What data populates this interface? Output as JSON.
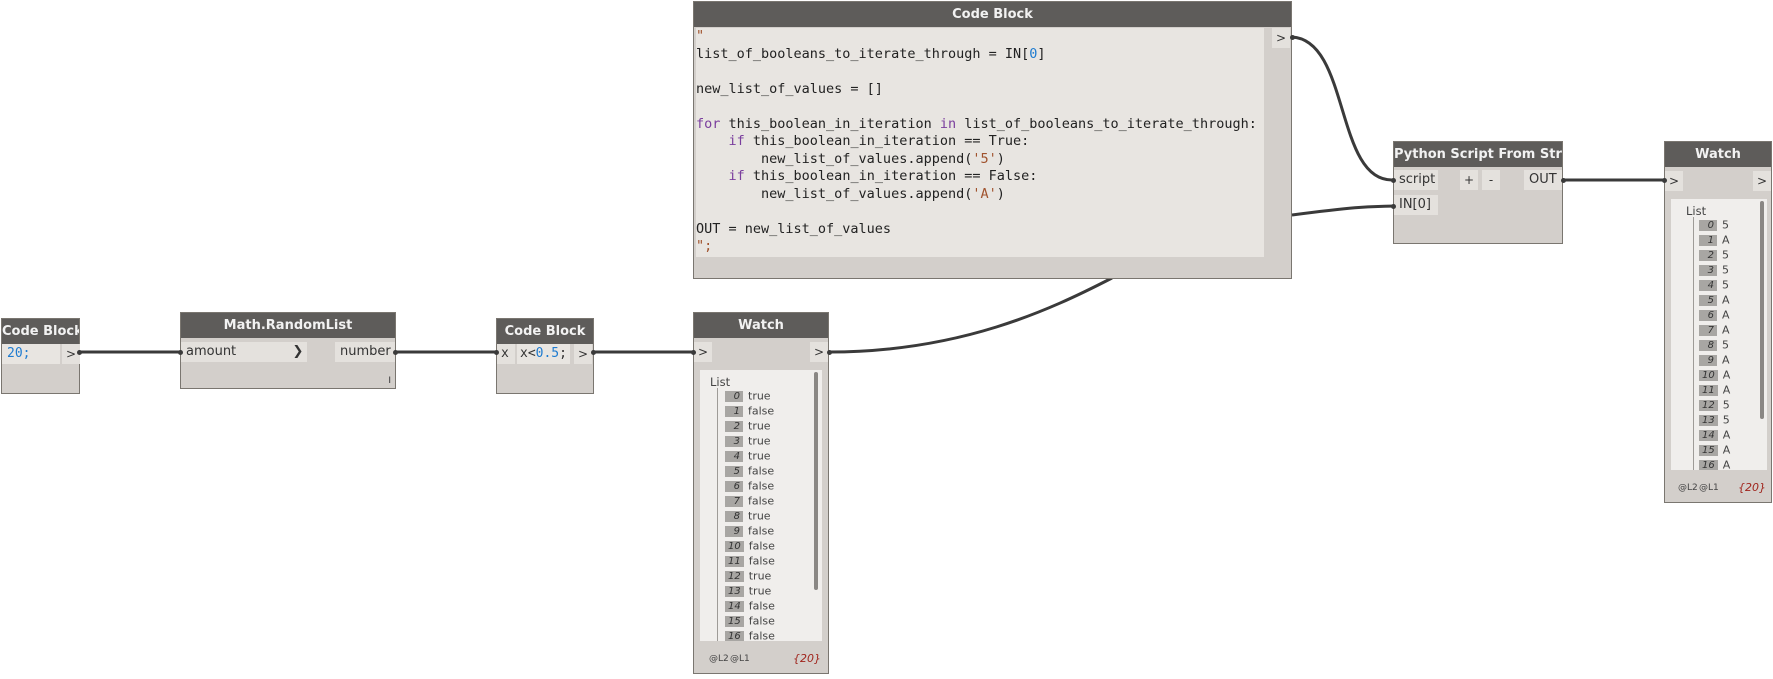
{
  "nodes": {
    "code_block_20": {
      "title": "Code Block",
      "code": "20;",
      "output_arrow": ">"
    },
    "random_list": {
      "title": "Math.RandomList",
      "input": "amount",
      "output": "number",
      "lacing": "I"
    },
    "code_block_cmp": {
      "title": "Code Block",
      "input": "x",
      "code": "x<0.5;",
      "output_arrow": ">"
    },
    "watch_1": {
      "title": "Watch",
      "input_arrow": ">",
      "output_arrow": ">",
      "list_title": "List",
      "items": [
        {
          "i": "0",
          "v": "true"
        },
        {
          "i": "1",
          "v": "false"
        },
        {
          "i": "2",
          "v": "true"
        },
        {
          "i": "3",
          "v": "true"
        },
        {
          "i": "4",
          "v": "true"
        },
        {
          "i": "5",
          "v": "false"
        },
        {
          "i": "6",
          "v": "false"
        },
        {
          "i": "7",
          "v": "false"
        },
        {
          "i": "8",
          "v": "true"
        },
        {
          "i": "9",
          "v": "false"
        },
        {
          "i": "10",
          "v": "false"
        },
        {
          "i": "11",
          "v": "false"
        },
        {
          "i": "12",
          "v": "true"
        },
        {
          "i": "13",
          "v": "true"
        },
        {
          "i": "14",
          "v": "false"
        },
        {
          "i": "15",
          "v": "false"
        },
        {
          "i": "16",
          "v": "false"
        }
      ],
      "level_l2": "@L2",
      "level_l1": "@L1",
      "count": "{20}"
    },
    "code_block_python": {
      "title": "Code Block",
      "output_arrow": ">",
      "lines": [
        "\"",
        "list_of_booleans_to_iterate_through = IN[0]",
        "",
        "new_list_of_values = []",
        "",
        "for this_boolean_in_iteration in list_of_booleans_to_iterate_through:",
        "    if this_boolean_in_iteration == True:",
        "        new_list_of_values.append('5')",
        "    if this_boolean_in_iteration == False:",
        "        new_list_of_values.append('A')",
        "",
        "OUT = new_list_of_values",
        "\";"
      ]
    },
    "python_from_string": {
      "title": "Python Script From String",
      "input_script": "script",
      "input_in0": "IN[0]",
      "add_btn": "+",
      "remove_btn": "-",
      "output": "OUT"
    },
    "watch_2": {
      "title": "Watch",
      "input_arrow": ">",
      "output_arrow": ">",
      "list_title": "List",
      "items": [
        {
          "i": "0",
          "v": "5"
        },
        {
          "i": "1",
          "v": "A"
        },
        {
          "i": "2",
          "v": "5"
        },
        {
          "i": "3",
          "v": "5"
        },
        {
          "i": "4",
          "v": "5"
        },
        {
          "i": "5",
          "v": "A"
        },
        {
          "i": "6",
          "v": "A"
        },
        {
          "i": "7",
          "v": "A"
        },
        {
          "i": "8",
          "v": "5"
        },
        {
          "i": "9",
          "v": "A"
        },
        {
          "i": "10",
          "v": "A"
        },
        {
          "i": "11",
          "v": "A"
        },
        {
          "i": "12",
          "v": "5"
        },
        {
          "i": "13",
          "v": "5"
        },
        {
          "i": "14",
          "v": "A"
        },
        {
          "i": "15",
          "v": "A"
        },
        {
          "i": "16",
          "v": "A"
        }
      ],
      "level_l2": "@L2",
      "level_l1": "@L1",
      "count": "{20}"
    }
  },
  "colors": {
    "header": "#5e5c5a",
    "node_body": "#d3cfcb",
    "wire": "#3a3a3a",
    "keyword": "#7a3e9d",
    "number": "#1e7bd0",
    "string": "#a0522d"
  }
}
